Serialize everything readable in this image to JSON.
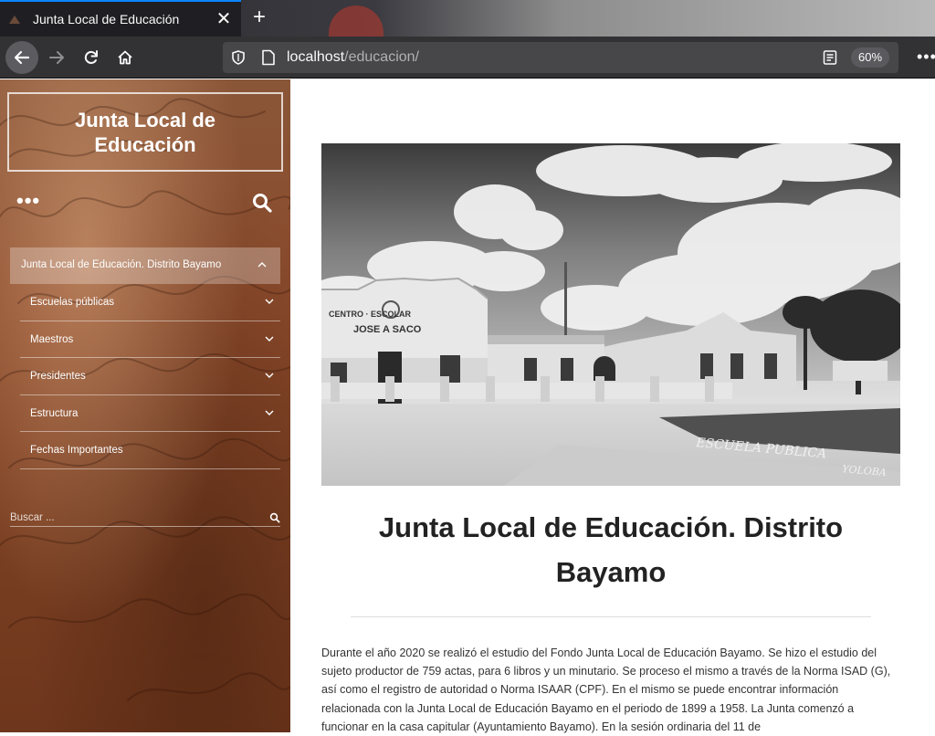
{
  "browser": {
    "tab_title": "Junta Local de Educación",
    "tab_close": "✕",
    "new_tab": "+",
    "url_host": "localhost",
    "url_path": "/educacion/",
    "zoom": "60%",
    "menu": "•••"
  },
  "site": {
    "title": "Junta Local de Educación",
    "more": "•••",
    "menu": {
      "top": "Junta Local de Educación. Distrito Bayamo",
      "items": [
        {
          "label": "Escuelas públicas",
          "has_children": true
        },
        {
          "label": "Maestros",
          "has_children": true
        },
        {
          "label": "Presidentes",
          "has_children": true
        },
        {
          "label": "Estructura",
          "has_children": true
        },
        {
          "label": "Fechas Importantes",
          "has_children": false
        }
      ]
    },
    "search_placeholder": "Buscar ..."
  },
  "post": {
    "image_signs": {
      "building_sign_top": "CENTRO · ESCOLAR",
      "building_sign_name": "JOSE A SACO",
      "street_sign": "ESCUELA PUBLICA",
      "street_sign_2": "YOLOBA"
    },
    "title": "Junta Local de Educación. Distrito Bayamo",
    "body": "Durante el año 2020 se realizó el estudio del Fondo Junta Local de Educación Bayamo. Se hizo el estudio del sujeto productor de 759 actas, para 6 libros y un minutario. Se proceso el mismo a través de la Norma ISAD (G), así como el registro de autoridad o Norma ISAAR (CPF). En el mismo se puede encontrar información relacionada con la Junta Local de Educación Bayamo en el periodo de 1899 a 1958. La Junta comenzó a funcionar en la casa capitular (Ayuntamiento Bayamo). En la sesión ordinaria del 11 de"
  },
  "colors": {
    "tab_accent": "#0a84ff",
    "sidebar_brown": "#8b4a2b",
    "title_text": "#222222"
  }
}
